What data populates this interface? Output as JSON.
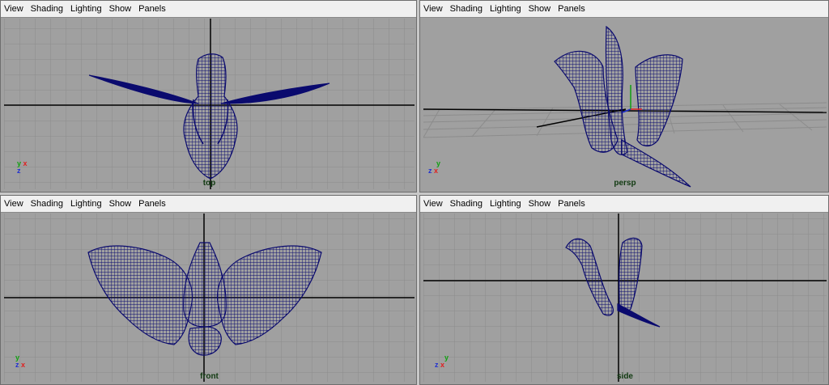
{
  "menu": [
    "View",
    "Shading",
    "Lighting",
    "Show",
    "Panels"
  ],
  "panels": {
    "top": {
      "camera": "top"
    },
    "persp": {
      "camera": "persp"
    },
    "front": {
      "camera": "front"
    },
    "side": {
      "camera": "side"
    }
  },
  "axes": {
    "x": "x",
    "y": "y",
    "z": "z"
  },
  "colors": {
    "viewport_bg": "#a0a0a0",
    "grid": "#8c8c8c",
    "origin_axis": "#000000",
    "wireframe": "#0a0a6e",
    "menubar": "#f0f0f0",
    "axis_x": "#e02020",
    "axis_y": "#10a010",
    "axis_z": "#2030d0"
  }
}
